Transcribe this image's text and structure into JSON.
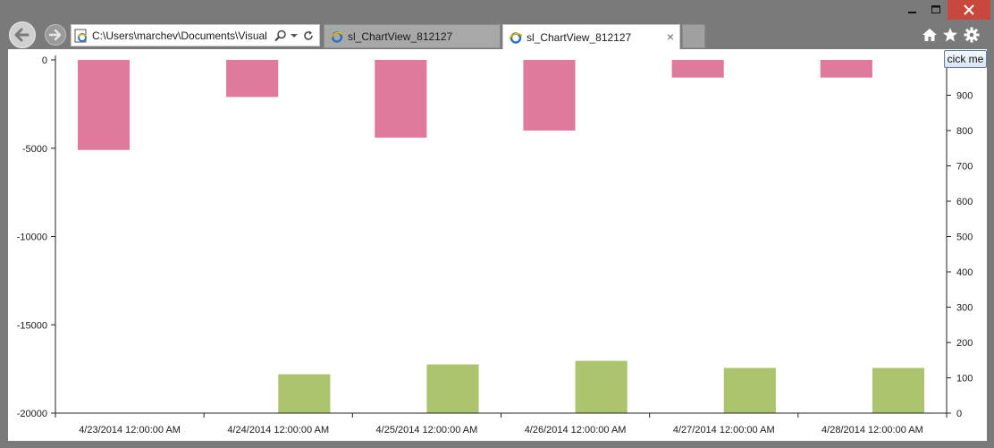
{
  "address_bar": {
    "url": "C:\\Users\\marchev\\Documents\\Visual",
    "search_icon": "search-icon",
    "dropdown_icon": "chevron-down-icon",
    "refresh_icon": "refresh-icon"
  },
  "tabs": [
    {
      "label": "sl_ChartView_812127",
      "active": false
    },
    {
      "label": "sl_ChartView_812127",
      "active": true,
      "close": "×"
    }
  ],
  "toolbar": {
    "home_icon": "home-icon",
    "favorites_icon": "star-icon",
    "tools_icon": "gear-icon"
  },
  "colors": {
    "negative_bar": "#e07a9c",
    "positive_bar": "#adc46f",
    "close_button": "#c9483e"
  },
  "button": {
    "label": "cick me"
  },
  "chart_data": {
    "type": "bar",
    "categories": [
      "4/23/2014 12:00:00 AM",
      "4/24/2014 12:00:00 AM",
      "4/25/2014 12:00:00 AM",
      "4/26/2014 12:00:00 AM",
      "4/27/2014 12:00:00 AM",
      "4/28/2014 12:00:00 AM"
    ],
    "series": [
      {
        "axis": "left",
        "values": [
          -5100,
          -2100,
          -4400,
          -4000,
          -1000,
          -1000
        ]
      },
      {
        "axis": "right",
        "values": [
          0,
          110,
          138,
          148,
          128,
          128
        ]
      }
    ],
    "left_axis": {
      "ylim": [
        -20000,
        0
      ],
      "ticks": [
        "0",
        "-5000",
        "-10000",
        "-15000",
        "-20000"
      ],
      "tick_values": [
        0,
        -5000,
        -10000,
        -15000,
        -20000
      ]
    },
    "right_axis": {
      "ylim": [
        0,
        1000
      ],
      "ticks": [
        "0",
        "100",
        "200",
        "300",
        "400",
        "500",
        "600",
        "700",
        "800",
        "900"
      ],
      "tick_values": [
        0,
        100,
        200,
        300,
        400,
        500,
        600,
        700,
        800,
        900
      ]
    },
    "grid": false
  }
}
